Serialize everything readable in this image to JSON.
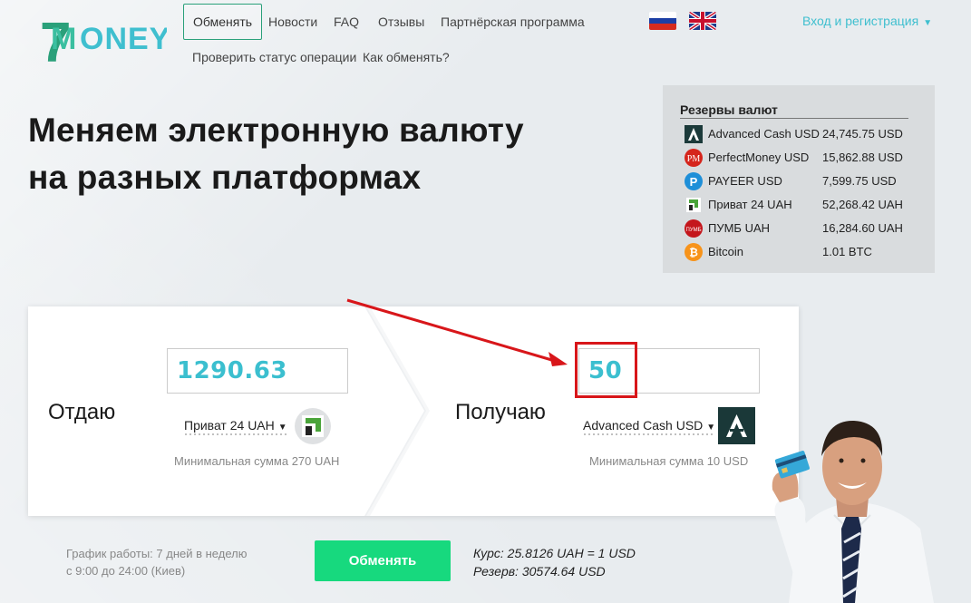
{
  "header": {
    "nav": {
      "exchange": "Обменять",
      "news": "Новости",
      "faq": "FAQ",
      "reviews": "Отзывы",
      "partner": "Партнёрская программа",
      "check_status": "Проверить статус операции",
      "how_to": "Как обменять?"
    },
    "login": "Вход и регистрация",
    "flags": [
      "russia-flag-icon",
      "uk-flag-icon"
    ]
  },
  "hero": {
    "line1": "Меняем электронную валюту",
    "line2": "на разных платформах"
  },
  "reserves": {
    "title": "Резервы валют",
    "items": [
      {
        "name": "Advanced Cash USD",
        "amount": "24,745.75 USD",
        "icon": "advcash-icon"
      },
      {
        "name": "PerfectMoney USD",
        "amount": "15,862.88 USD",
        "icon": "perfectmoney-icon"
      },
      {
        "name": "PAYEER USD",
        "amount": "7,599.75 USD",
        "icon": "payeer-icon"
      },
      {
        "name": "Приват 24 UAH",
        "amount": "52,268.42 UAH",
        "icon": "privat24-icon"
      },
      {
        "name": "ПУМБ UAH",
        "amount": "16,284.60 UAH",
        "icon": "pumb-icon"
      },
      {
        "name": "Bitcoin",
        "amount": "1.01 BTC",
        "icon": "bitcoin-icon"
      }
    ]
  },
  "exchange": {
    "give": {
      "label": "Отдаю",
      "amount": "1290.63",
      "currency": "Приват 24 UAH",
      "min": "Минимальная сумма 270 UAH"
    },
    "get": {
      "label": "Получаю",
      "amount": "50",
      "currency": "Advanced Cash USD",
      "min": "Минимальная сумма 10 USD"
    }
  },
  "footer": {
    "schedule_line1": "График работы: 7 дней в неделю",
    "schedule_line2": "с 9:00 до 24:00 (Киев)",
    "button": "Обменять",
    "rate": "Курс: 25.8126 UAH = 1 USD",
    "reserve": "Резерв: 30574.64 USD"
  },
  "colors": {
    "accent": "#3fbfcf",
    "button": "#17d97e",
    "highlight": "#d8161a",
    "logo_green": "#2aa07a"
  }
}
